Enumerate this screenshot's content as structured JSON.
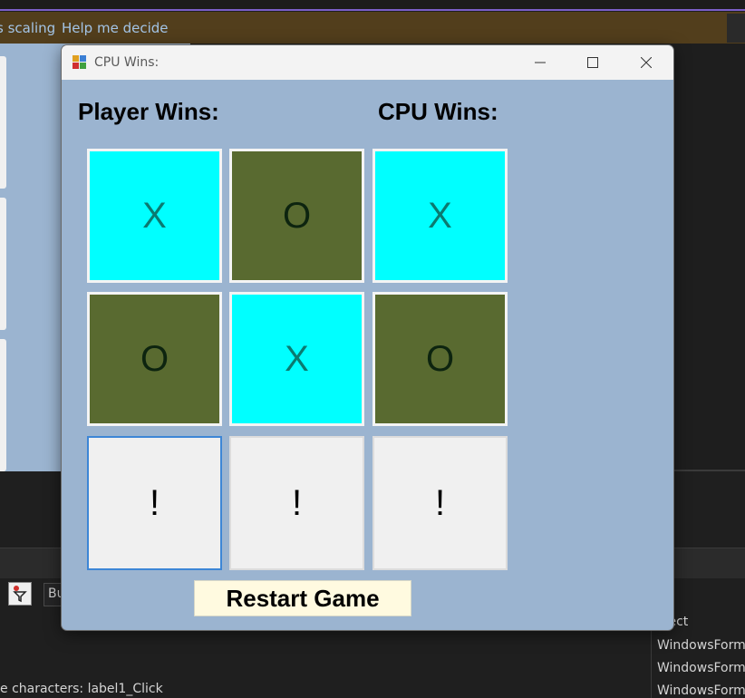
{
  "ide": {
    "infobar_links": [
      "s scaling",
      "Help me decide"
    ],
    "toolbar_partial": "Bu",
    "status_text": "e characters: label1_Click",
    "right_list": [
      "oject",
      "WindowsForms",
      "WindowsForms",
      "WindowsForms"
    ]
  },
  "window": {
    "title": "CPU Wins:",
    "controls": [
      "minimize-icon",
      "maximize-icon",
      "close-icon"
    ]
  },
  "scores": {
    "player_label": "Player Wins:",
    "cpu_label": "CPU Wins:"
  },
  "board": {
    "cells": [
      "X",
      "O",
      "X",
      "O",
      "X",
      "O",
      "!",
      "!",
      "!"
    ],
    "colors": {
      "x_bg": "#00ffff",
      "x_text": "#0b7a70",
      "o_bg": "#596a30",
      "o_text": "#0d240f",
      "blank_bg": "#f0f0f0"
    }
  },
  "restart_label": "Restart Game",
  "colors": {
    "form_bg": "#9bb4d0",
    "restart_bg": "#fffae0",
    "ide_infobar": "#523e1c"
  }
}
